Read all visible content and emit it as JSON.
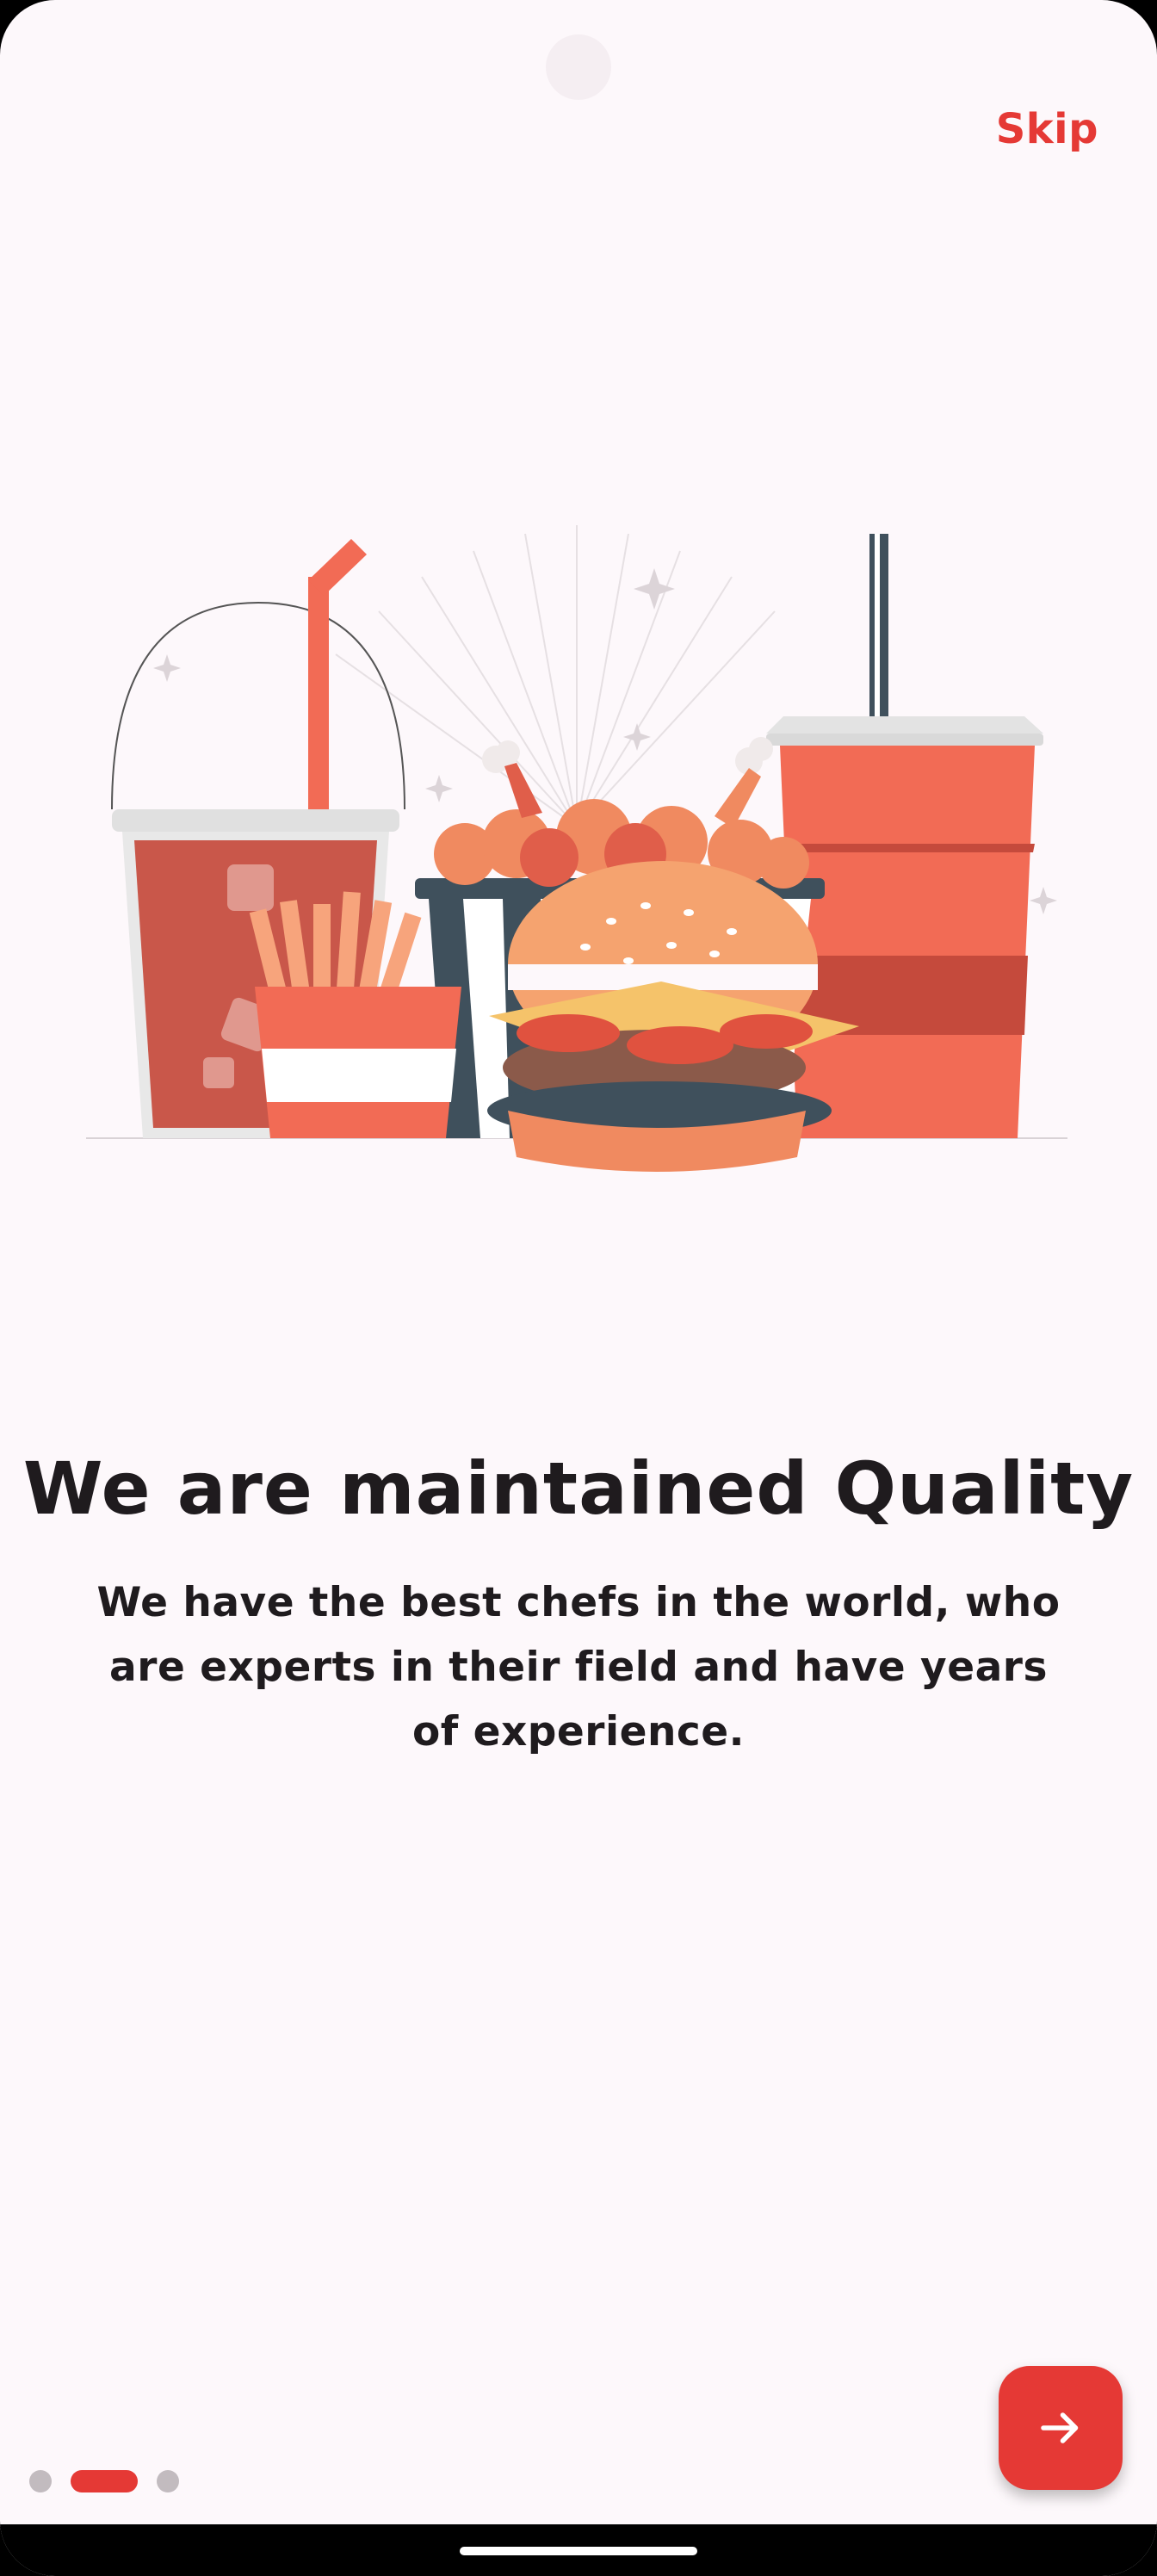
{
  "onboarding": {
    "skip_label": "Skip",
    "title": "We are maintained Quality",
    "description": "We have the best chefs in the world, who are experts in their field and have years of experience.",
    "page_indicator": {
      "total": 3,
      "active_index": 1
    },
    "next_button_icon": "arrow-right-icon",
    "illustration": "fast-food-illustration"
  },
  "colors": {
    "accent": "#e53935",
    "background": "#fdf8fb",
    "text": "#1f1b1e",
    "inactive_dot": "#c2bbbf"
  }
}
